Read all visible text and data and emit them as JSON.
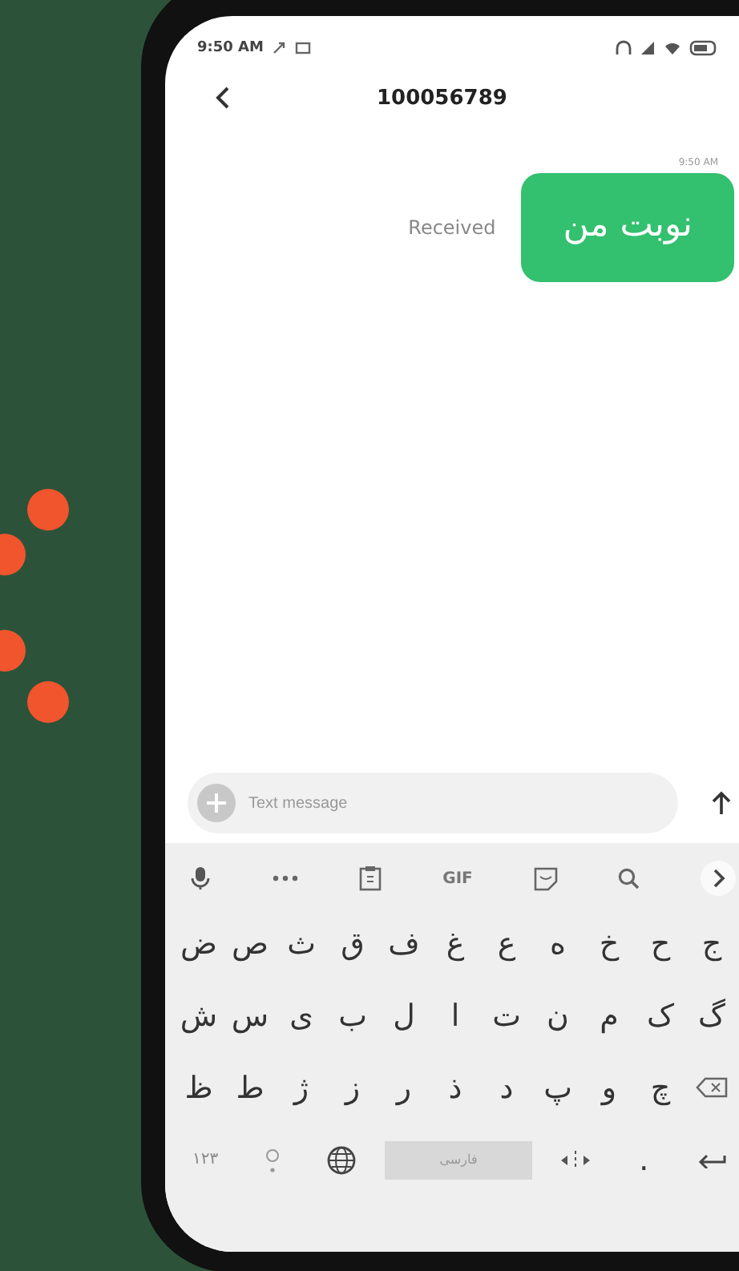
{
  "status_bar": {
    "time": "9:50 AM"
  },
  "header": {
    "title": "100056789"
  },
  "messages": [
    {
      "timestamp": "9:50 AM",
      "status": "Received",
      "text": "نوبت من"
    }
  ],
  "composer": {
    "placeholder": "Text message"
  },
  "keyboard": {
    "toolbar": [
      {
        "kind": "mic"
      },
      {
        "kind": "more"
      },
      {
        "kind": "clipboard"
      },
      {
        "kind": "gif",
        "label": "GIF"
      },
      {
        "kind": "sticker"
      },
      {
        "kind": "search"
      },
      {
        "kind": "expand"
      }
    ],
    "rows": [
      [
        "ج",
        "ح",
        "خ",
        "ه",
        "ع",
        "غ",
        "ف",
        "ق",
        "ث",
        "ص",
        "ض"
      ],
      [
        "گ",
        "ک",
        "م",
        "ن",
        "ت",
        "ا",
        "ل",
        "ب",
        "ی",
        "س",
        "ش"
      ],
      [
        {
          "kind": "backspace"
        },
        "چ",
        "و",
        "پ",
        "د",
        "ذ",
        "ر",
        "ز",
        "ژ",
        "ط",
        "ظ"
      ]
    ],
    "bottom_row": [
      {
        "kind": "enter"
      },
      {
        "kind": "period",
        "label": "."
      },
      {
        "kind": "cursor"
      },
      {
        "kind": "space",
        "label": "فارسی"
      },
      {
        "kind": "globe"
      },
      {
        "kind": "emoji"
      },
      {
        "kind": "symbols",
        "label": "۱۲۳"
      }
    ]
  }
}
